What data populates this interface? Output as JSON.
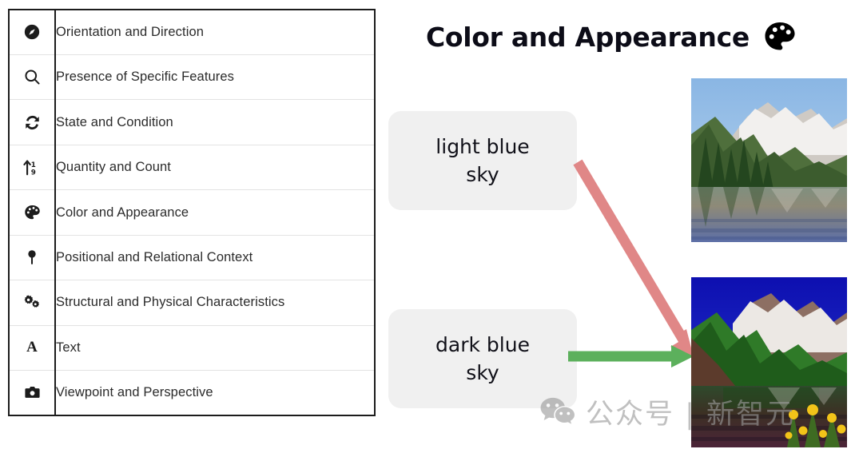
{
  "table": {
    "rows": [
      {
        "icon": "compass-icon",
        "label": "Orientation and Direction"
      },
      {
        "icon": "magnifier-icon",
        "label": "Presence of Specific Features"
      },
      {
        "icon": "sync-arrows-icon",
        "label": "State and Condition"
      },
      {
        "icon": "sort-numeric-up-icon",
        "label": "Quantity and Count"
      },
      {
        "icon": "palette-icon",
        "label": "Color and Appearance"
      },
      {
        "icon": "map-pin-icon",
        "label": "Positional and Relational Context"
      },
      {
        "icon": "gears-icon",
        "label": "Structural and Physical Characteristics"
      },
      {
        "icon": "letter-a-icon",
        "label": "Text"
      },
      {
        "icon": "camera-icon",
        "label": "Viewpoint and Perspective"
      }
    ]
  },
  "panel": {
    "title": "Color and Appearance",
    "title_icon": "palette-icon",
    "chips": [
      {
        "text": "light blue\nsky"
      },
      {
        "text": "dark blue\nsky"
      }
    ],
    "arrows": [
      {
        "name": "red-arrow",
        "color": "#e08787",
        "from": "light blue sky",
        "to": "dark blue sky image"
      },
      {
        "name": "green-arrow",
        "color": "#5cb05c",
        "from": "dark blue sky",
        "to": "dark blue sky image"
      }
    ],
    "photos": [
      {
        "name": "mountain-lake-light-sky",
        "sky": "#9dc4e8"
      },
      {
        "name": "mountain-lake-dark-sky",
        "sky": "#1a1fb4"
      }
    ]
  },
  "watermark": {
    "text": "公众号 | 新智元",
    "logo": "wechat-icon"
  },
  "colors": {
    "chip_bg": "#f0f0f0",
    "table_border": "#1c1c1c",
    "red_arrow": "#e08787",
    "green_arrow": "#5cb05c"
  }
}
